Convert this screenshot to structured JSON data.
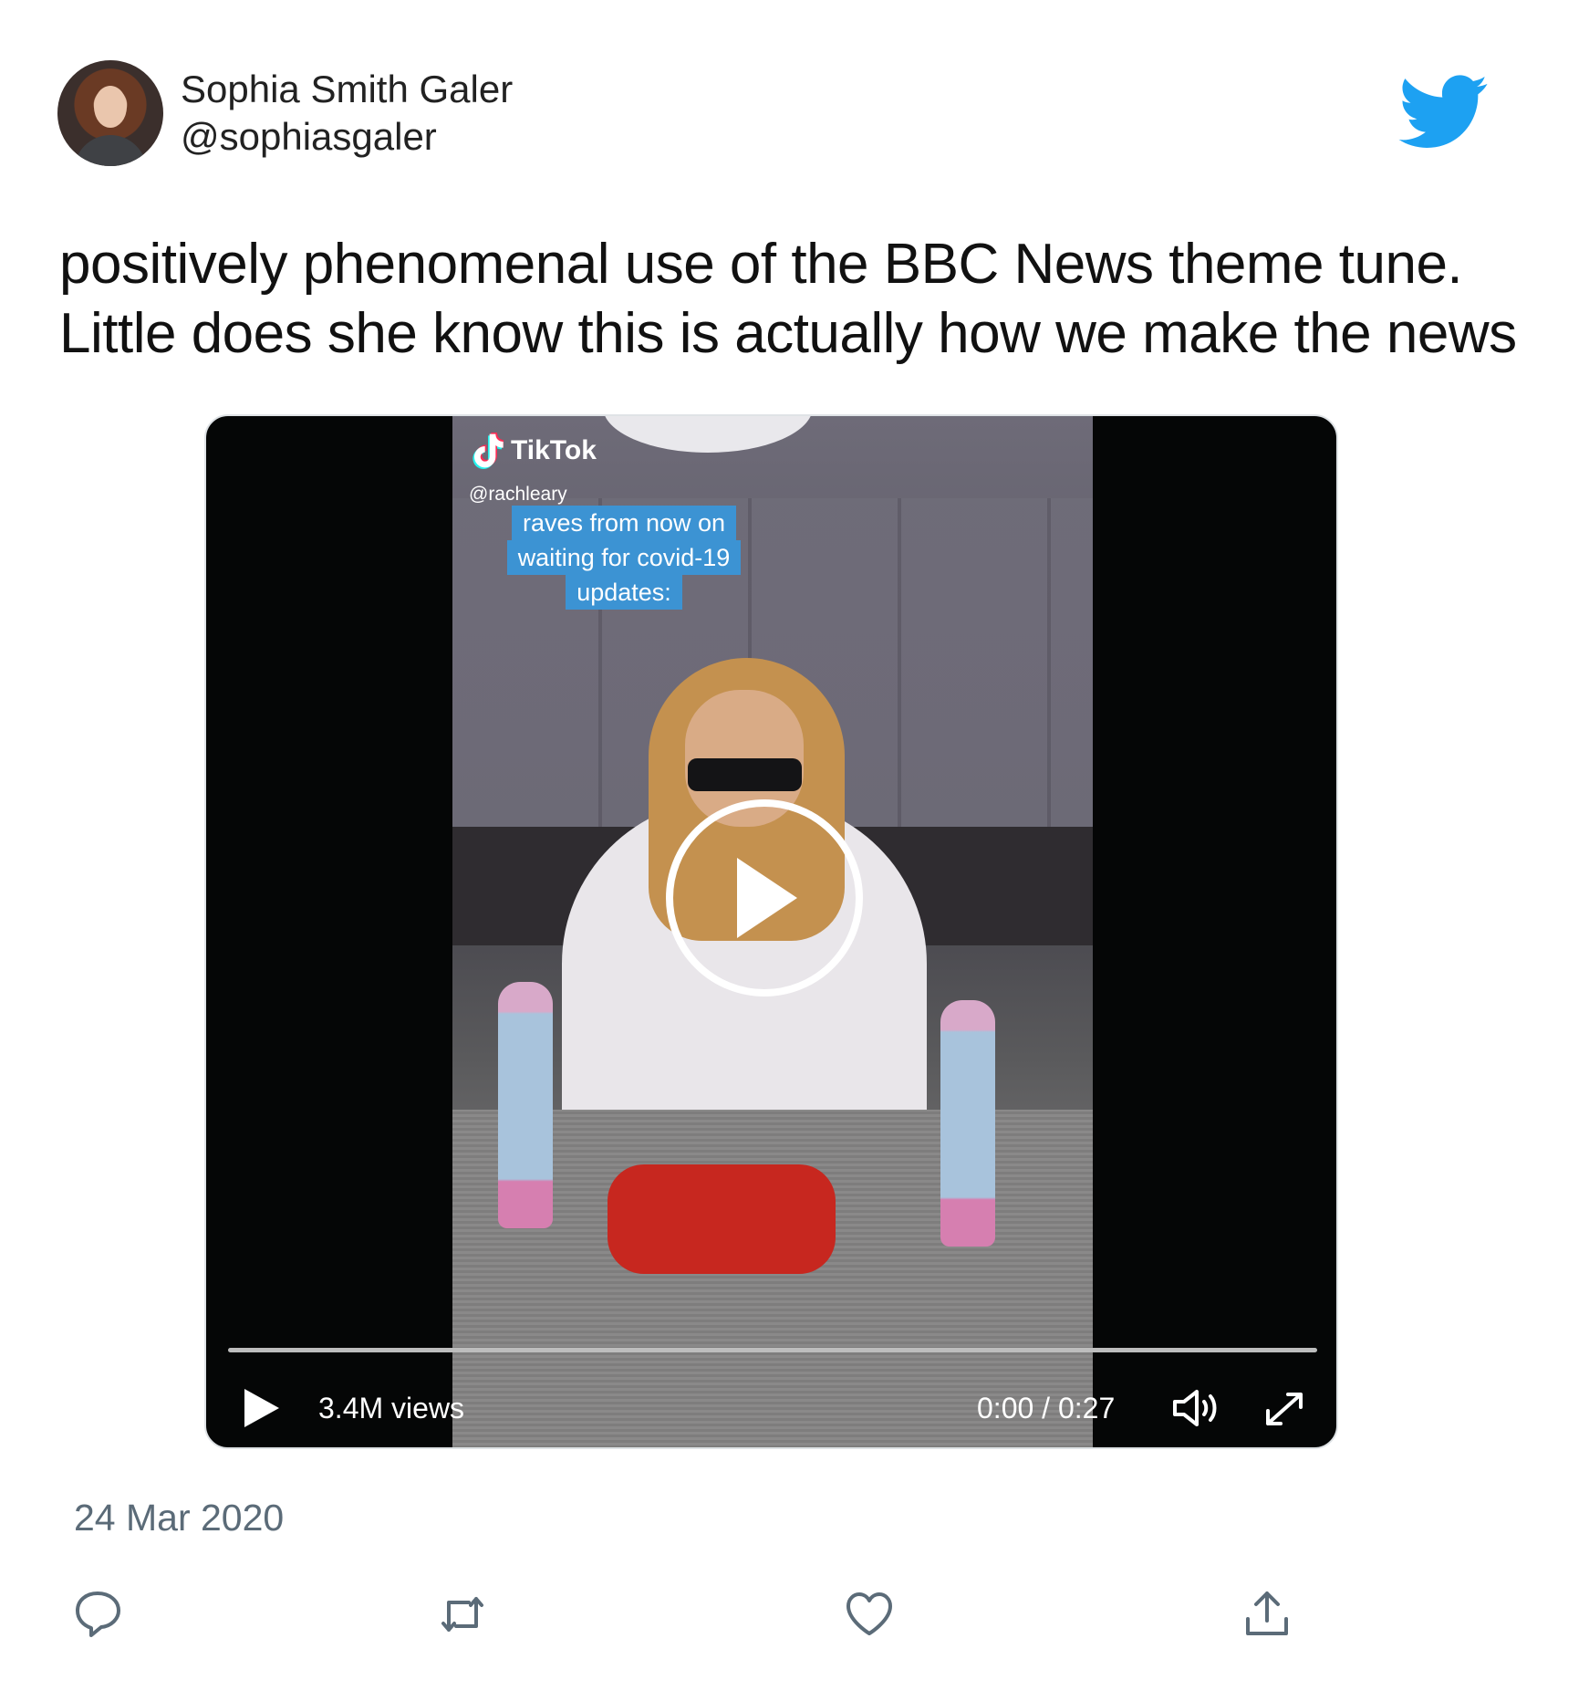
{
  "author": {
    "display_name": "Sophia Smith Galer",
    "handle": "@sophiasgaler"
  },
  "tweet": {
    "text_lines": [
      "positively phenomenal use of the BBC News theme tune.",
      "Little does she know this is actually how we make the news"
    ],
    "date": "24 Mar 2020"
  },
  "video": {
    "overlay": {
      "brand": "TikTok",
      "username": "@rachleary",
      "caption_lines": [
        "raves from now on",
        "waiting for covid-19",
        "updates:"
      ]
    },
    "views": "3.4M views",
    "time": "0:00 / 0:27",
    "progress": 0
  },
  "icons": {
    "brand": "twitter-bird-icon",
    "actions": [
      "reply-icon",
      "retweet-icon",
      "like-icon",
      "share-icon"
    ]
  },
  "colors": {
    "twitter_blue": "#1da1f2",
    "caption_bg": "#3c93d3",
    "date_gray": "#5b6b78"
  }
}
